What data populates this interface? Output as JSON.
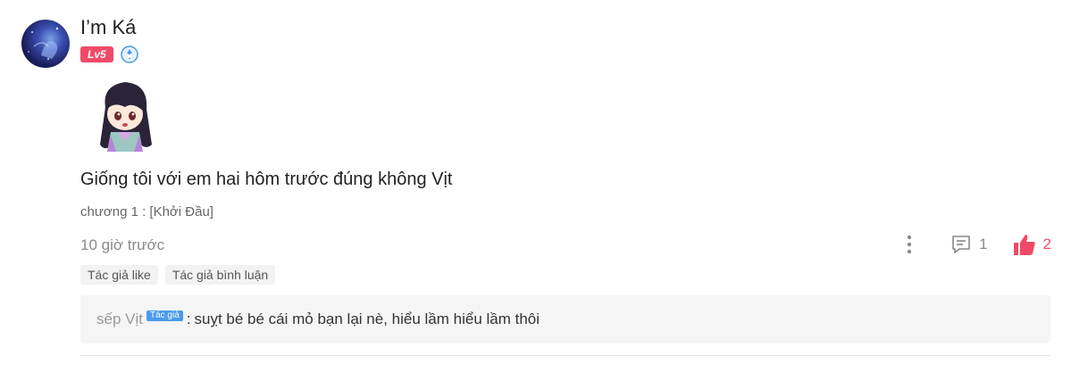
{
  "user": {
    "name": "I’m Ká",
    "level": "Lv5"
  },
  "comment": {
    "text": "Giống tôi với em hai hôm trước đúng không Vịt",
    "chapter": "chương 1 : [Khởi Đầu]",
    "time": "10 giờ trước",
    "reply_count": "1",
    "like_count": "2"
  },
  "tags": [
    "Tác giả like",
    "Tác giả bình luận"
  ],
  "reply": {
    "author": "sếp Vịt",
    "author_tag": "Tác giả",
    "separator": ":",
    "text": "suỵt bé bé cái mỏ bạn lại nè, hiểu lầm hiểu lầm thôi"
  },
  "colors": {
    "accent": "#f04a66",
    "author_tag": "#4a9bea",
    "muted": "#8a8a8a"
  },
  "icons": [
    "avatar-image",
    "medal-icon",
    "sticker-image",
    "more-vertical-icon",
    "comment-icon",
    "thumbs-up-icon"
  ]
}
